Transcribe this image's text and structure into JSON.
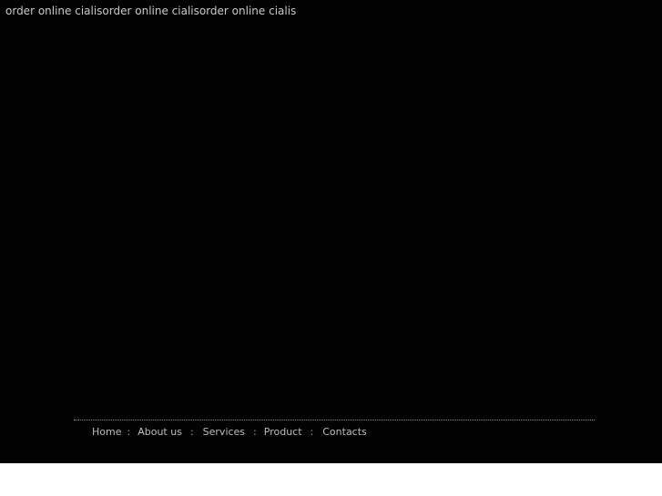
{
  "page": {
    "top_text": "order online cialisorder online cialisorder online cialis"
  },
  "footer": {
    "nav": [
      {
        "label": "Home"
      },
      {
        "label": "About us"
      },
      {
        "label": "Services"
      },
      {
        "label": "Product"
      },
      {
        "label": "Contacts"
      }
    ],
    "separator": ":"
  },
  "colors": {
    "background": "#020202",
    "text": "#c9c9c9",
    "footer_divider": "#8f8f8f"
  }
}
